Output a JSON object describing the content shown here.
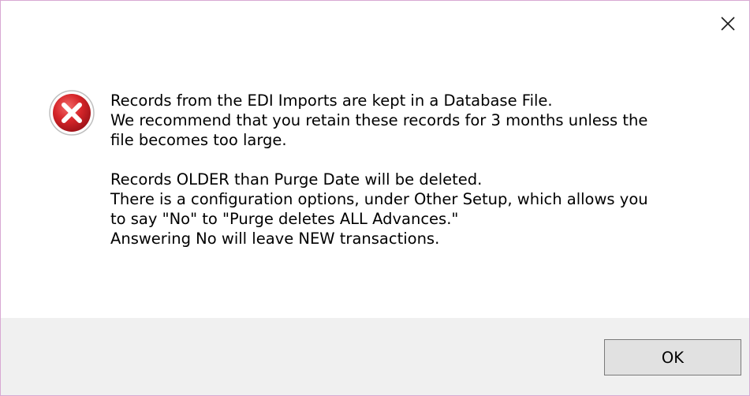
{
  "dialog": {
    "close_icon": "close-icon",
    "error_icon": "error-icon",
    "message_lines": [
      "Records from the EDI Imports are kept in a Database File.",
      "We recommend that you retain these records for 3 months unless the",
      "file becomes too large.",
      "",
      "Records OLDER than Purge Date will be deleted.",
      "There is a configuration options, under Other Setup, which allows you",
      "to say \"No\" to \"Purge deletes ALL Advances.\"",
      "Answering No will leave NEW transactions."
    ],
    "ok_label": "OK"
  },
  "colors": {
    "border": "#d8a9d3",
    "footer_bg": "#f0f0f0",
    "button_bg": "#e1e1e1",
    "icon_red": "#d6262a"
  }
}
